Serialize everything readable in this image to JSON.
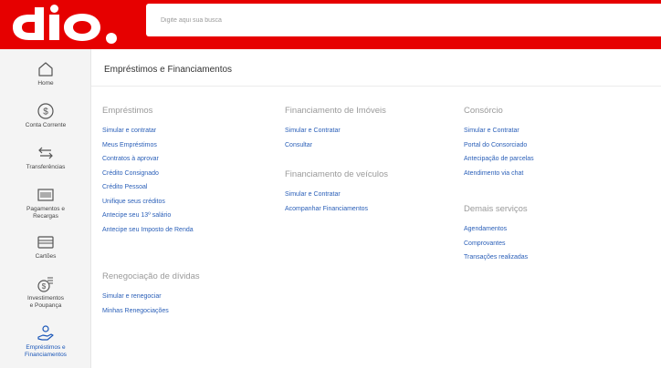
{
  "search": {
    "placeholder": "Digite aqui sua busca"
  },
  "sidebar": {
    "items": [
      {
        "label": "Home",
        "icon": "home-icon"
      },
      {
        "label": "Conta Corrente",
        "icon": "dollar-coin-icon"
      },
      {
        "label": "Transferências",
        "icon": "transfer-arrows-icon"
      },
      {
        "label": "Pagamentos e\nRecargas",
        "icon": "barcode-icon"
      },
      {
        "label": "Cartões",
        "icon": "card-icon"
      },
      {
        "label": "Investimentos\ne Poupança",
        "icon": "investment-coins-icon"
      },
      {
        "label": "Empréstimos e\nFinanciamentos",
        "icon": "hand-coin-icon"
      }
    ]
  },
  "page": {
    "title": "Empréstimos e Financiamentos"
  },
  "emprestimos": {
    "title": "Empréstimos",
    "links": [
      "Simular e contratar",
      "Meus Empréstimos",
      "Contratos à aprovar",
      "Crédito Consignado",
      "Crédito Pessoal",
      "Unifique seus créditos",
      "Antecipe seu 13º salário",
      "Antecipe seu Imposto de Renda"
    ]
  },
  "renegociacao": {
    "title": "Renegociação de dívidas",
    "links": [
      "Simular e renegociar",
      "Minhas Renegociações"
    ]
  },
  "imoveis": {
    "title": "Financiamento de Imóveis",
    "links": [
      "Simular e Contratar",
      "Consultar"
    ]
  },
  "veiculos": {
    "title": "Financiamento de veículos",
    "links": [
      "Simular e Contratar",
      "Acompanhar Financiamentos"
    ]
  },
  "consorcio": {
    "title": "Consórcio",
    "links": [
      "Simular e Contratar",
      "Portal do Consorciado",
      "Antecipação de parcelas",
      "Atendimento via chat"
    ]
  },
  "demais": {
    "title": "Demais serviços",
    "links": [
      "Agendamentos",
      "Comprovantes",
      "Transações realizadas"
    ]
  },
  "colors": {
    "header": "#e60000",
    "link": "#2a5fb8",
    "section": "#9a9a9a",
    "active": "#1a56b8"
  }
}
